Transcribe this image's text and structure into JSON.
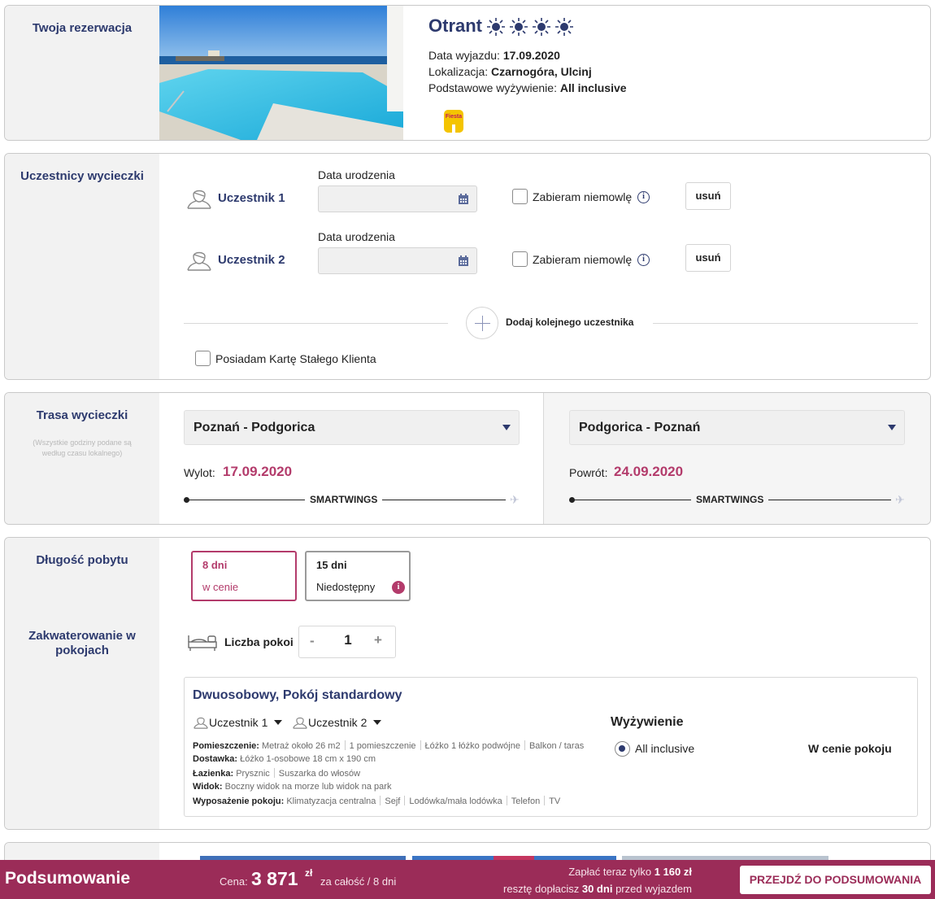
{
  "reservation": {
    "section_title": "Twoja rezerwacja",
    "hotel_name": "Otrant",
    "stars": 4,
    "departure_label": "Data wyjazdu:",
    "departure_value": "17.09.2020",
    "location_label": "Lokalizacja:",
    "location_value": "Czarnogóra, Ulcinj",
    "board_label": "Podstawowe wyżywienie:",
    "board_value": "All inclusive",
    "logo_text": "Fiesta"
  },
  "participants": {
    "section_title": "Uczestnicy wycieczki",
    "items": [
      {
        "label": "Uczestnik 1",
        "date_label": "Data urodzenia",
        "infant_label": "Zabieram niemowlę",
        "remove_label": "usuń"
      },
      {
        "label": "Uczestnik 2",
        "date_label": "Data urodzenia",
        "infant_label": "Zabieram niemowlę",
        "remove_label": "usuń"
      }
    ],
    "add_label": "Dodaj kolejnego uczestnika",
    "loyalty_label": "Posiadam Kartę Stałego Klienta"
  },
  "route": {
    "section_title": "Trasa wycieczki",
    "note": "(Wszystkie godziny podane są według czasu lokalnego)",
    "outbound": {
      "route": "Poznań - Podgorica",
      "label": "Wylot:",
      "date": "17.09.2020",
      "airline": "SMARTWINGS"
    },
    "inbound": {
      "route": "Podgorica - Poznań",
      "label": "Powrót:",
      "date": "24.09.2020",
      "airline": "SMARTWINGS"
    }
  },
  "stay": {
    "section_title": "Długość pobytu",
    "options": [
      {
        "days": "8 dni",
        "status": "w cenie",
        "selected": true
      },
      {
        "days": "15 dni",
        "status": "Niedostępny",
        "selected": false,
        "badge": "i"
      }
    ]
  },
  "accommodation": {
    "section_title": "Zakwaterowanie w pokojach",
    "rooms_label": "Liczba pokoi",
    "rooms_minus": "-",
    "rooms_count": "1",
    "rooms_plus": "+",
    "room": {
      "title": "Dwuosobowy, Pokój standardowy",
      "participants": [
        "Uczestnik 1",
        "Uczestnik 2"
      ],
      "specs": [
        {
          "label": "Pomieszczenie:",
          "values": [
            "Metraż około 26 m2",
            "1 pomieszczenie",
            "Łóżko 1 łóżko podwójne",
            "Balkon / taras"
          ]
        },
        {
          "label": "Dostawka:",
          "values": [
            "Łóżko 1-osobowe 18 cm x 190 cm"
          ]
        },
        {
          "label": "Łazienka:",
          "values": [
            "Prysznic",
            "Suszarka do włosów"
          ]
        },
        {
          "label": "Widok:",
          "values": [
            "Boczny widok na morze lub widok na park"
          ]
        },
        {
          "label": "Wyposażenie pokoju:",
          "values": [
            "Klimatyzacja centralna",
            "Sejf",
            "Lodówka/mała lodówka",
            "Telefon",
            "TV"
          ]
        }
      ],
      "board_title": "Wyżywienie",
      "board_option": "All inclusive",
      "price_note": "W cenie pokoju"
    }
  },
  "summary": {
    "title": "Podsumowanie",
    "price_label": "Cena:",
    "price_value": "3 871",
    "currency": "zł",
    "price_suffix": "za całość / 8 dni",
    "pay_now_text": "Zapłać teraz tylko",
    "pay_now_value": "1 160 zł",
    "rest_prefix": "resztę dopłacisz",
    "rest_value": "30 dni",
    "rest_suffix": "przed wyjazdem",
    "button_label": "PRZEJDŹ DO PODSUMOWANIA"
  },
  "colors": {
    "navy": "#2d3a6e",
    "accent": "#b33b6b",
    "summary_bg": "#9b2c58"
  }
}
